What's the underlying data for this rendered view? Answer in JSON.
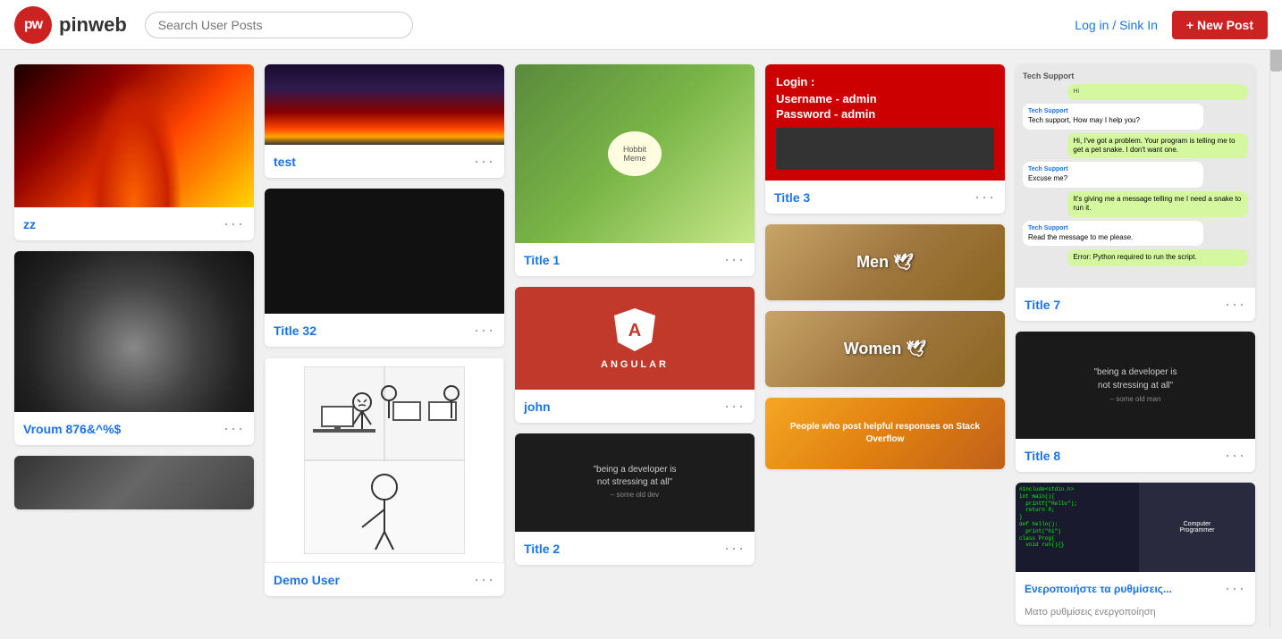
{
  "header": {
    "logo_initials": "pw",
    "logo_name": "pinweb",
    "search_placeholder": "Search User Posts",
    "login_label": "Log in / Sink In",
    "new_post_label": "+ New Post"
  },
  "columns": [
    {
      "id": "col1",
      "cards": [
        {
          "id": "card-zz",
          "image_type": "fire",
          "title": "zz",
          "has_title": true
        },
        {
          "id": "card-vroum",
          "image_type": "car",
          "title": "Vroum 876&^%$",
          "has_title": true
        },
        {
          "id": "card-motorcycle",
          "image_type": "motorcycle",
          "title": "",
          "has_title": false
        }
      ]
    },
    {
      "id": "col2",
      "cards": [
        {
          "id": "card-test",
          "image_type": "city",
          "title": "test",
          "has_title": true
        },
        {
          "id": "card-title32",
          "image_type": "dark",
          "title": "Title 32",
          "has_title": true
        },
        {
          "id": "card-demouser",
          "image_type": "stickman",
          "title": "Demo User",
          "has_title": true
        }
      ]
    },
    {
      "id": "col3",
      "cards": [
        {
          "id": "card-title1",
          "image_type": "hobbit",
          "title": "Title 1",
          "has_title": true
        },
        {
          "id": "card-john",
          "image_type": "angular",
          "title": "john",
          "has_title": true
        },
        {
          "id": "card-title2",
          "image_type": "dev2",
          "title": "Title 2",
          "has_title": true
        }
      ]
    },
    {
      "id": "col4",
      "cards": [
        {
          "id": "card-title3",
          "image_type": "login",
          "title": "Title 3",
          "has_title": true
        },
        {
          "id": "card-men",
          "image_type": "coffin-men",
          "title": "",
          "has_title": false
        },
        {
          "id": "card-women",
          "image_type": "coffin-women",
          "title": "",
          "has_title": false
        },
        {
          "id": "card-stackoverflow",
          "image_type": "stackoverflow",
          "title": "",
          "has_title": false
        }
      ]
    },
    {
      "id": "col5",
      "cards": [
        {
          "id": "card-title7",
          "image_type": "chat",
          "title": "Title 7",
          "has_title": true
        },
        {
          "id": "card-title8",
          "image_type": "dev3",
          "title": "Title 8",
          "has_title": true
        },
        {
          "id": "card-greek",
          "image_type": "programmer",
          "title": "Ενεροποιήστε τα ρυθμίσεις...",
          "has_title": true
        }
      ]
    }
  ],
  "dots_label": "···"
}
